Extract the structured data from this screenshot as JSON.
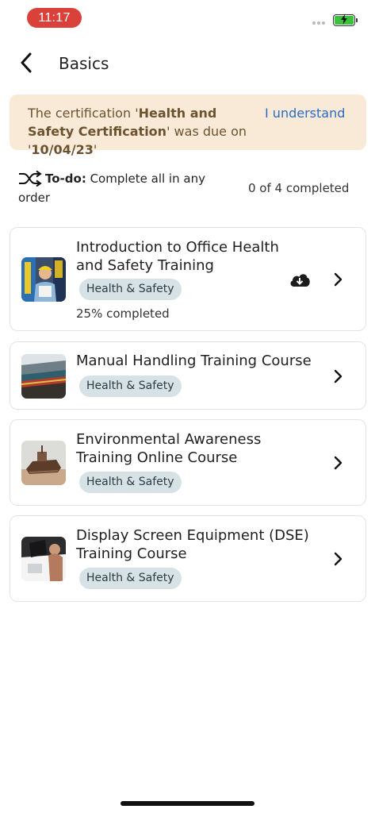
{
  "status_bar": {
    "time": "11:17",
    "time_pill_color": "#d9413a",
    "battery_color": "#3ac23c",
    "icons": [
      "signal-dots-icon",
      "battery-charging-icon"
    ]
  },
  "header": {
    "title": "Basics",
    "back_icon": "chevron-left-icon"
  },
  "banner": {
    "text_prefix": "The certification '",
    "cert_name": "Health and Safety Certification",
    "text_middle": "' was due on '",
    "due_date": "10/04/23",
    "text_suffix": "'",
    "action_label": "I understand",
    "background": "#f9ead8",
    "link_color": "#2a6bc4"
  },
  "todo": {
    "icon": "shuffle-icon",
    "label": "To-do:",
    "description": " Complete all in any order",
    "progress": "0 of 4 completed"
  },
  "courses": [
    {
      "title": "Introduction to Office Health and Safety Training",
      "tag": "Health & Safety",
      "progress": "25% completed",
      "download_icon": "cloud-download-icon"
    },
    {
      "title": "Manual Handling Training Course",
      "tag": "Health & Safety"
    },
    {
      "title": "Environmental Awareness Training Online Course",
      "tag": "Health & Safety"
    },
    {
      "title": "Display Screen Equipment (DSE) Training Course",
      "tag": "Health & Safety"
    }
  ],
  "colors": {
    "tag_background": "#d7e2e6",
    "card_border": "#e3e3e3"
  }
}
